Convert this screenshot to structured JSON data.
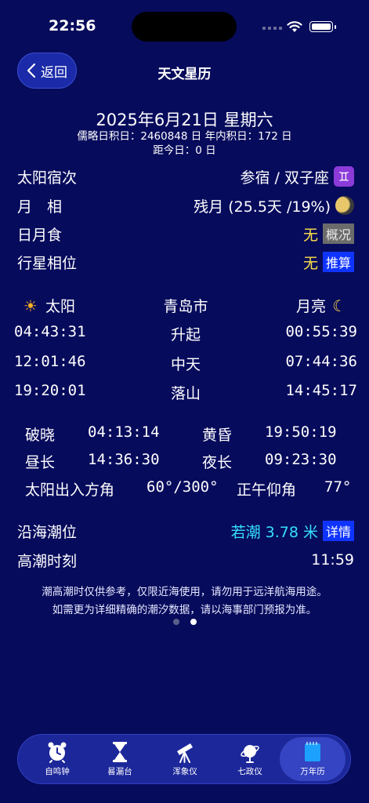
{
  "status_bar": {
    "time": "22:56"
  },
  "nav": {
    "back_label": "返回",
    "title": "天文星历"
  },
  "date": {
    "main": "2025年6月21日 星期六",
    "julian": "儒略日积日：2460848 日  年内积日：172 日",
    "days_from_today": "距今日：0 日"
  },
  "info": {
    "sun_station_label": "太阳宿次",
    "sun_station_value": "参宿 / 双子座",
    "zodiac_symbol": "♊",
    "moon_phase_label": "月　相",
    "moon_phase_value": "残月 (25.5天 /19%)",
    "eclipse_label": "日月食",
    "eclipse_value": "无",
    "eclipse_button": "概况",
    "planet_label": "行星相位",
    "planet_value": "无",
    "planet_button": "推算"
  },
  "rise_set": {
    "sun_header": "太阳",
    "city": "青岛市",
    "moon_header": "月亮",
    "rows": [
      {
        "sun": "04:43:31",
        "label": "升起",
        "moon": "00:55:39"
      },
      {
        "sun": "12:01:46",
        "label": "中天",
        "moon": "07:44:36"
      },
      {
        "sun": "19:20:01",
        "label": "落山",
        "moon": "14:45:17"
      }
    ]
  },
  "twilight": {
    "dawn_label": "破晓",
    "dawn_value": "04:13:14",
    "dusk_label": "黄昏",
    "dusk_value": "19:50:19",
    "day_label": "昼长",
    "day_value": "14:36:30",
    "night_label": "夜长",
    "night_value": "09:23:30",
    "azimuth_label": "太阳出入方角",
    "azimuth_value": "60°/300°",
    "noon_label": "正午仰角",
    "noon_value": "77°"
  },
  "tide": {
    "level_label": "沿海潮位",
    "level_value": "若潮 3.78 米",
    "details_button": "详情",
    "high_label": "高潮时刻",
    "high_value": "11:59"
  },
  "disclaimer": {
    "line1": "潮高潮时仅供参考，仅限近海使用，请勿用于远洋航海用途。",
    "line2": "如需更为详细精确的潮汐数据，请以海事部门预报为准。"
  },
  "page_dots": {
    "count": 2,
    "active": 1
  },
  "tabs": [
    {
      "label": "自鸣钟",
      "icon": "alarm-clock-icon"
    },
    {
      "label": "晷漏台",
      "icon": "hourglass-icon"
    },
    {
      "label": "浑象仪",
      "icon": "telescope-icon"
    },
    {
      "label": "七政仪",
      "icon": "planet-icon"
    },
    {
      "label": "万年历",
      "icon": "calendar-icon",
      "active": true
    }
  ],
  "colors": {
    "background": "#070b5c",
    "yellow": "#ffe14a",
    "cyan": "#35e0ff",
    "button_blue": "#1034ff"
  }
}
